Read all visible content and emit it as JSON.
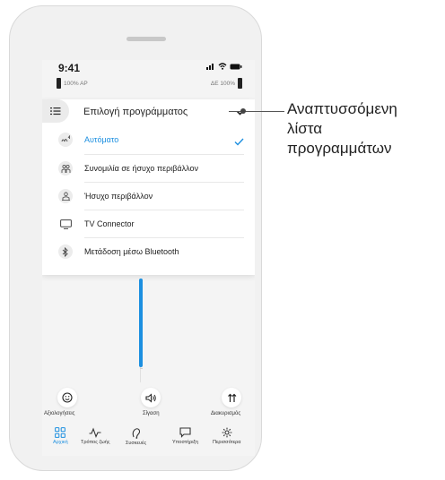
{
  "status_bar": {
    "time": "9:41",
    "left_device": "100% AP",
    "right_device": "ΔΕ 100%"
  },
  "program_list": {
    "title": "Επιλογή προγράμματος",
    "items": [
      {
        "label": "Αυτόματο",
        "selected": true,
        "icon": "auto-hearing-icon"
      },
      {
        "label": "Συνομιλία σε ήσυχο περιβάλλον",
        "selected": false,
        "icon": "people-conversation-icon"
      },
      {
        "label": "Ήσυχο περιβάλλον",
        "selected": false,
        "icon": "person-quiet-icon"
      },
      {
        "label": "TV Connector",
        "selected": false,
        "icon": "tv-icon"
      },
      {
        "label": "Μετάδοση μέσω Bluetooth",
        "selected": false,
        "icon": "bluetooth-icon"
      }
    ]
  },
  "volume": {
    "level": 0.99
  },
  "actions": {
    "rate": "Αξιολογήσεις",
    "mute": "Σίγαση",
    "adjust": "Διακυρισμός"
  },
  "nav": {
    "home": "Αρχική",
    "lifestyle": "Τρόπος ζωής",
    "devices": "Συσκευές",
    "support": "Υποστήριξη",
    "more": "Περισσότερα"
  },
  "callout": {
    "line1": "Αναπτυσσόμενη",
    "line2": "λίστα",
    "line3": "προγραμμάτων"
  },
  "colors": {
    "accent": "#1c8fe0"
  }
}
